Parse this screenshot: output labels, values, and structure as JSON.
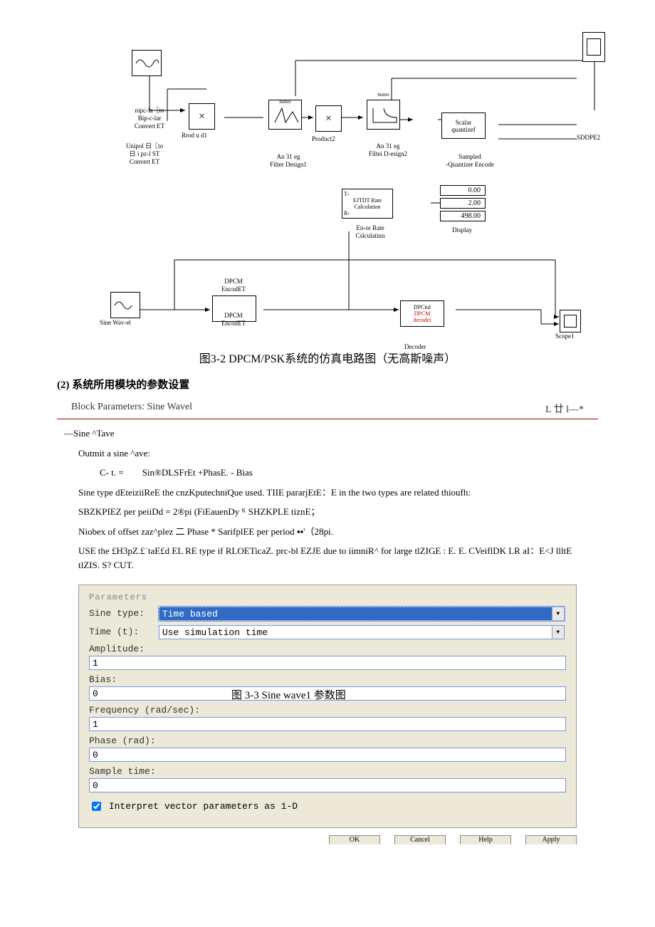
{
  "diagram": {
    "blocks": {
      "unipolar_label": "nipc-la〖to\nBip-c-lar\nConvert ET",
      "unipolar_label2": "Unipol 日〖to\n日 i pz-l ST\nConvert ET",
      "product1": "Rrod u d1",
      "butter1_top": "butter",
      "butter1_sub": "An 31 eg\nFilter Design1",
      "product2": "Product2",
      "butter2_top": "butter",
      "butter2_sub": "An 31 eg\nFiltei D-esign2",
      "scalar": "Scalar\nquantizef",
      "scalar_sub": "Sampled\n-Quantizer Encode",
      "scope2": "SDDPE2",
      "error_calc": "EJTDT Rate\nCalculation",
      "error_sub": "En-or Rate\nCslculatinn",
      "display_sub": "Display",
      "display_vals": [
        "0.00",
        "2.00",
        "498.00"
      ],
      "sine_wave1": "Sine Wav-el",
      "dpcm_enc": "DPCM\nEncodET",
      "dpcm_enc2": "DPCM\nEncodET",
      "dpcm_dec": "DPCM\ndecodei",
      "dpcm_dec_top": "DPCtul",
      "decoder_sub": "Decoder",
      "scope1": "Scope1"
    },
    "caption": "图3-2 DPCM/PSK系统的仿真电路图（无高斯噪声）"
  },
  "section2_heading": "(2) 系统所用模块的参数设置",
  "param_dialog": {
    "title": "Block Parameters: Sine Wavel",
    "title_right": "L 廿 l—*",
    "desc_heading": "—Sine ^Tave",
    "desc_line1": "Outmit a sine ^ave:",
    "desc_formula": "C- t. =        Sin®DLSFrEt +PhasE. - Bias",
    "desc_p1": "Sine type dEteiziiReE the cnzKputechniQue used. TIIE pararjEtE：E in the two types are related thioufh:",
    "desc_p2": "SBZKPIEZ per peiiDd = 2®pi (FiEauenDy ᴷ SHZKPLE tiznE；",
    "desc_p3": "Niobex of offset zaz^plez 二 Phase * SarifplEE per period ▪▪'（28pi.",
    "desc_p4": "USE the £H3pZ.£˙taE£d EL RE type if RLOETicaZ. prc-bl EZJE due to iimniR^ for large tlZIGE : E. E. CVeiflDK LR aI：E<J llltE tlZIS. S? CUT.",
    "fieldset": "Parameters",
    "sine_type_label": "Sine type:",
    "sine_type_value": "Time based",
    "time_label": "Time (t):",
    "time_value": "Use simulation time",
    "amplitude_label": "Amplitude:",
    "amplitude_value": "1",
    "bias_label": "Bias:",
    "bias_value": "0",
    "fig_caption": "图 3-3    Sine wave1 参数图",
    "freq_label": "Frequency (rad/sec):",
    "freq_value": "1",
    "phase_label": "Phase (rad):",
    "phase_value": "0",
    "sample_label": "Sample time:",
    "sample_value": "0",
    "checkbox_label": "Interpret vector parameters as 1-D",
    "buttons": [
      "OK",
      "Cancel",
      "Help",
      "Apply"
    ]
  }
}
